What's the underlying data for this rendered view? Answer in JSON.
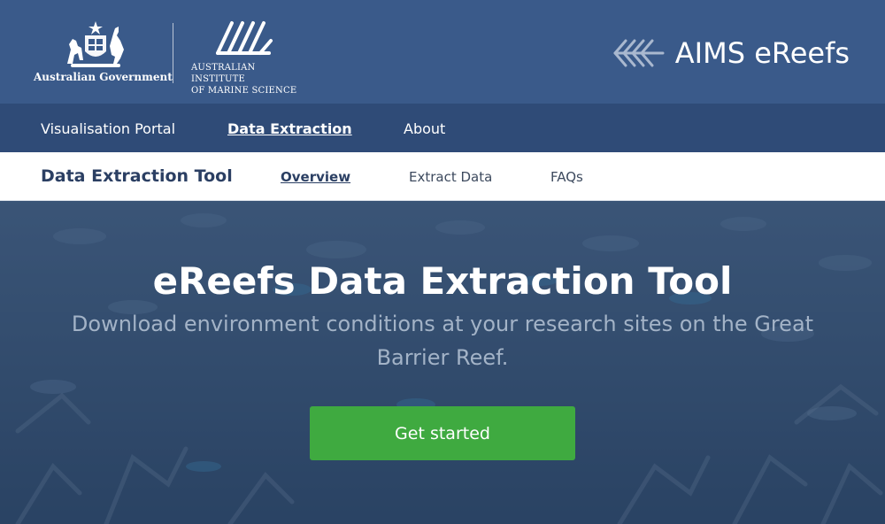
{
  "header": {
    "gov_text": "Australian Government",
    "institute_line1": "Australian Institute",
    "institute_line2": "of Marine Science",
    "brand": "AIMS eReefs"
  },
  "mainnav": {
    "items": [
      {
        "label": "Visualisation Portal"
      },
      {
        "label": "Data Extraction"
      },
      {
        "label": "About"
      }
    ],
    "active": "Data Extraction"
  },
  "subnav": {
    "title": "Data Extraction Tool",
    "items": [
      {
        "label": "Overview"
      },
      {
        "label": "Extract Data"
      },
      {
        "label": "FAQs"
      }
    ],
    "active": "Overview"
  },
  "hero": {
    "title": "eReefs Data Extraction Tool",
    "subtitle": "Download environment conditions at your research sites on the Great Barrier Reef.",
    "cta_label": "Get started"
  },
  "colors": {
    "header_bg": "#3a5a8a",
    "nav_bg": "#2f4b77",
    "cta_green": "#3faa40"
  }
}
